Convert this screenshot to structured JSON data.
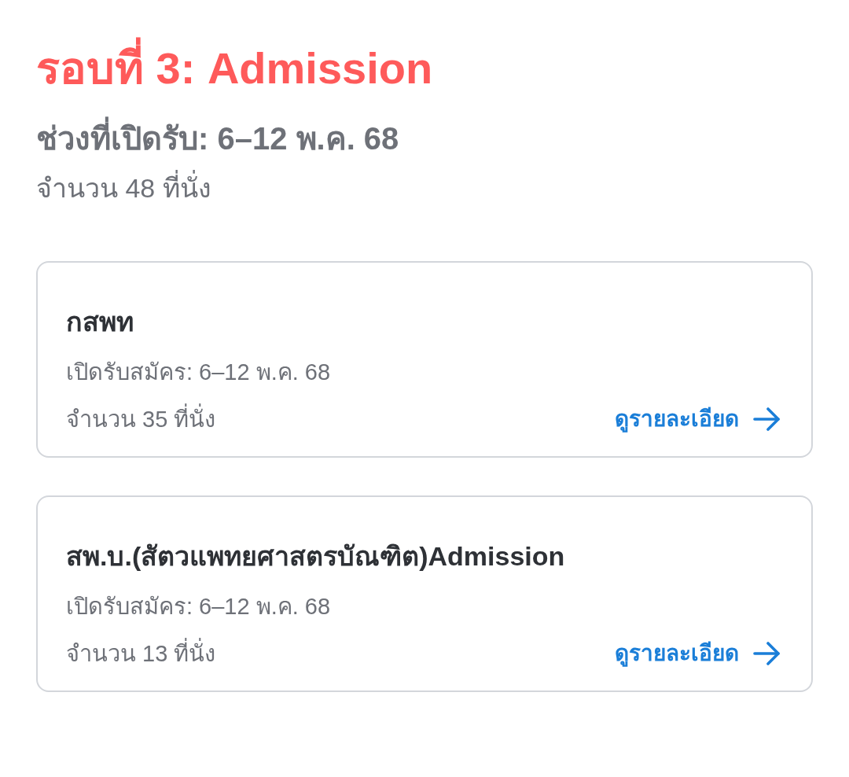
{
  "round": {
    "title": "รอบที่ 3: Admission",
    "period": "ช่วงที่เปิดรับ: 6–12 พ.ค. 68",
    "seats": "จำนวน 48 ที่นั่ง"
  },
  "programs": [
    {
      "name": "กสพท",
      "period": "เปิดรับสมัคร: 6–12 พ.ค. 68",
      "seats": "จำนวน 35 ที่นั่ง",
      "link": "ดูรายละเอียด"
    },
    {
      "name": "สพ.บ.(สัตวแพทยศาสตรบัณฑิต)Admission",
      "period": "เปิดรับสมัคร: 6–12 พ.ค. 68",
      "seats": "จำนวน 13 ที่นั่ง",
      "link": "ดูรายละเอียด"
    }
  ]
}
